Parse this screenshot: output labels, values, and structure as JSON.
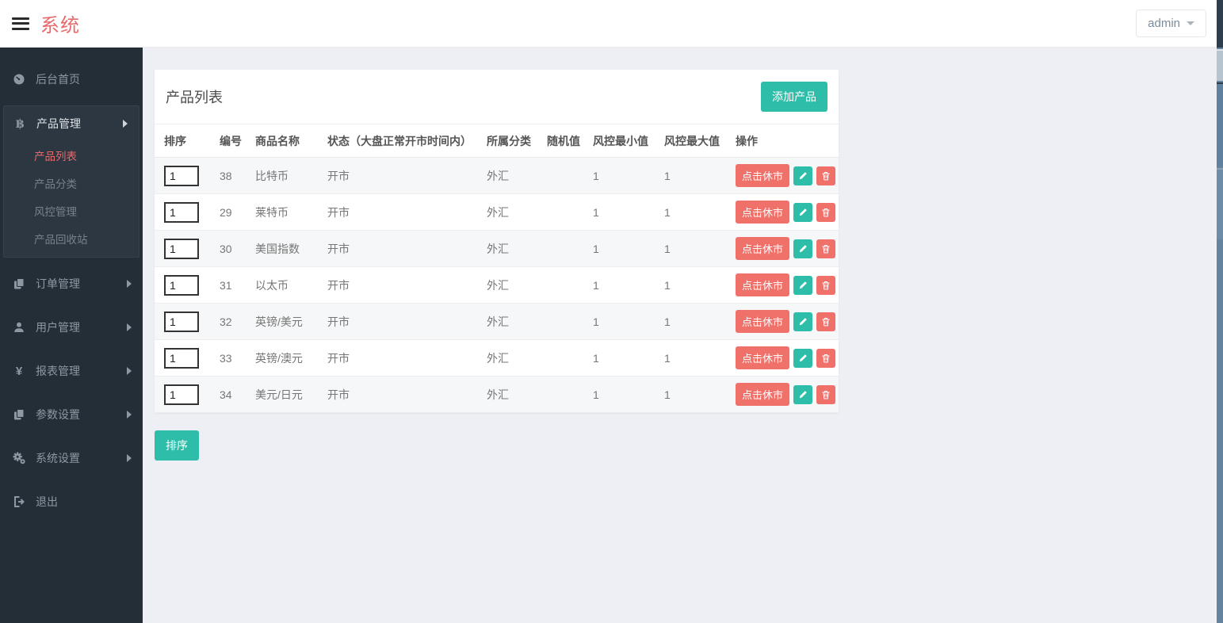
{
  "topbar": {
    "brand": "系统",
    "user_label": "admin"
  },
  "sidebar": {
    "items": [
      {
        "label": "后台首页",
        "icon": "dashboard-icon"
      },
      {
        "label": "产品管理",
        "icon": "bitcoin-icon",
        "expanded": true,
        "children": [
          "产品列表",
          "产品分类",
          "风控管理",
          "产品回收站"
        ],
        "active_child": "产品列表"
      },
      {
        "label": "订单管理",
        "icon": "files-icon"
      },
      {
        "label": "用户管理",
        "icon": "user-icon"
      },
      {
        "label": "报表管理",
        "icon": "yen-icon",
        "icon_glyph": "¥"
      },
      {
        "label": "参数设置",
        "icon": "files-icon"
      },
      {
        "label": "系统设置",
        "icon": "gears-icon"
      },
      {
        "label": "退出",
        "icon": "logout-icon"
      }
    ]
  },
  "main": {
    "card_title": "产品列表",
    "add_button_label": "添加产品",
    "sort_button_label": "排序",
    "table": {
      "headers": [
        "排序",
        "编号",
        "商品名称",
        "状态（大盘正常开市时间内）",
        "所属分类",
        "随机值",
        "风控最小值",
        "风控最大值",
        "操作"
      ],
      "actions": {
        "close_label": "点击休市"
      },
      "rows": [
        {
          "sort": "1",
          "id": "38",
          "name": "比特币",
          "status": "开市",
          "category": "外汇",
          "random": "",
          "risk_min": "1",
          "risk_max": "1"
        },
        {
          "sort": "1",
          "id": "29",
          "name": "莱特币",
          "status": "开市",
          "category": "外汇",
          "random": "",
          "risk_min": "1",
          "risk_max": "1"
        },
        {
          "sort": "1",
          "id": "30",
          "name": "美国指数",
          "status": "开市",
          "category": "外汇",
          "random": "",
          "risk_min": "1",
          "risk_max": "1"
        },
        {
          "sort": "1",
          "id": "31",
          "name": "以太币",
          "status": "开市",
          "category": "外汇",
          "random": "",
          "risk_min": "1",
          "risk_max": "1"
        },
        {
          "sort": "1",
          "id": "32",
          "name": "英镑/美元",
          "status": "开市",
          "category": "外汇",
          "random": "",
          "risk_min": "1",
          "risk_max": "1"
        },
        {
          "sort": "1",
          "id": "33",
          "name": "英镑/澳元",
          "status": "开市",
          "category": "外汇",
          "random": "",
          "risk_min": "1",
          "risk_max": "1"
        },
        {
          "sort": "1",
          "id": "34",
          "name": "美元/日元",
          "status": "开市",
          "category": "外汇",
          "random": "",
          "risk_min": "1",
          "risk_max": "1"
        }
      ]
    }
  },
  "colors": {
    "teal": "#2dbda8",
    "salmon": "#f0716a",
    "accent_red": "#e8696b",
    "sidebar_bg": "#242e37"
  }
}
